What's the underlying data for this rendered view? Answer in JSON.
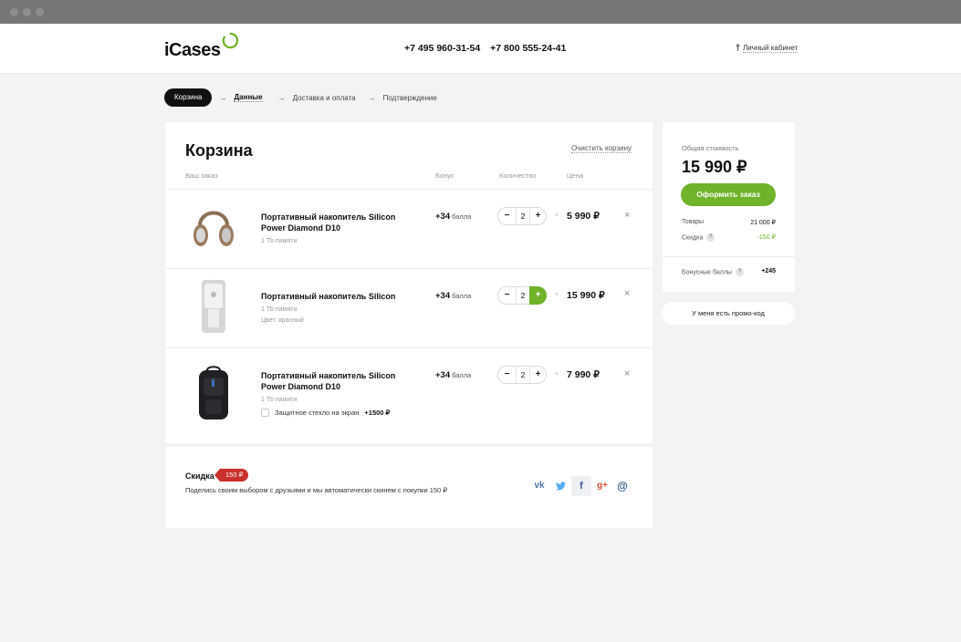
{
  "header": {
    "logo_text": "iCases",
    "phones": [
      "+7 495 960-31-54",
      "+7 800 555-24-41"
    ],
    "account_label": "Личный кабинет"
  },
  "steps": {
    "items": [
      "Корзина",
      "Данные",
      "Доставка и оплата",
      "Подтверждение"
    ]
  },
  "cart": {
    "title": "Корзина",
    "clear_label": "Очистить корзину",
    "columns": {
      "order": "Ваш заказ",
      "bonus": "Бонус",
      "quantity": "Количество",
      "price": "Цена"
    },
    "items": [
      {
        "name": "Портативный накопитель Silicon Power Diamond D10",
        "sub": "1 Tb памяти",
        "sub2": "",
        "bonus": "+34",
        "bonus_unit": "балла",
        "qty": "2",
        "price": "5 990 ₽",
        "image": "headphones"
      },
      {
        "name": "Портативный накопитель Silicon",
        "sub": "1 Tb памяти",
        "sub2": "Цвет: красный",
        "bonus": "+34",
        "bonus_unit": "балла",
        "qty": "2",
        "price": "15 990 ₽",
        "image": "speaker"
      },
      {
        "name": "Портативный накопитель Silicon Power Diamond D10",
        "sub": "1 Tb памяти",
        "sub2": "",
        "bonus": "+34",
        "bonus_unit": "балла",
        "qty": "2",
        "price": "7 990 ₽",
        "image": "backpack",
        "option_label": "Защитное стекло на экран",
        "option_price": "+1500 ₽"
      }
    ],
    "minus": "−",
    "plus": "+",
    "multiply": "×",
    "remove": "×"
  },
  "share": {
    "title": "Скидка",
    "badge": "150 ₽",
    "text": "Поделись своим выбором с друзьями и мы автоматически скинем с покупки 150 ₽",
    "networks": [
      "vk",
      "twitter",
      "facebook",
      "google-plus",
      "mail"
    ]
  },
  "summary": {
    "total_label": "Общая стоимость",
    "total": "15 990 ₽",
    "order_button": "Оформить заказ",
    "goods_label": "Товары",
    "goods_value": "21 000 ₽",
    "discount_label": "Скидка",
    "discount_value": "-150 ₽",
    "bonus_label": "Бонусные баллы",
    "bonus_value": "+245",
    "help": "?",
    "promo_label": "У меня есть промо-код"
  },
  "colors": {
    "accent": "#6fb32a",
    "badge": "#c9302c",
    "dark": "#111111"
  }
}
